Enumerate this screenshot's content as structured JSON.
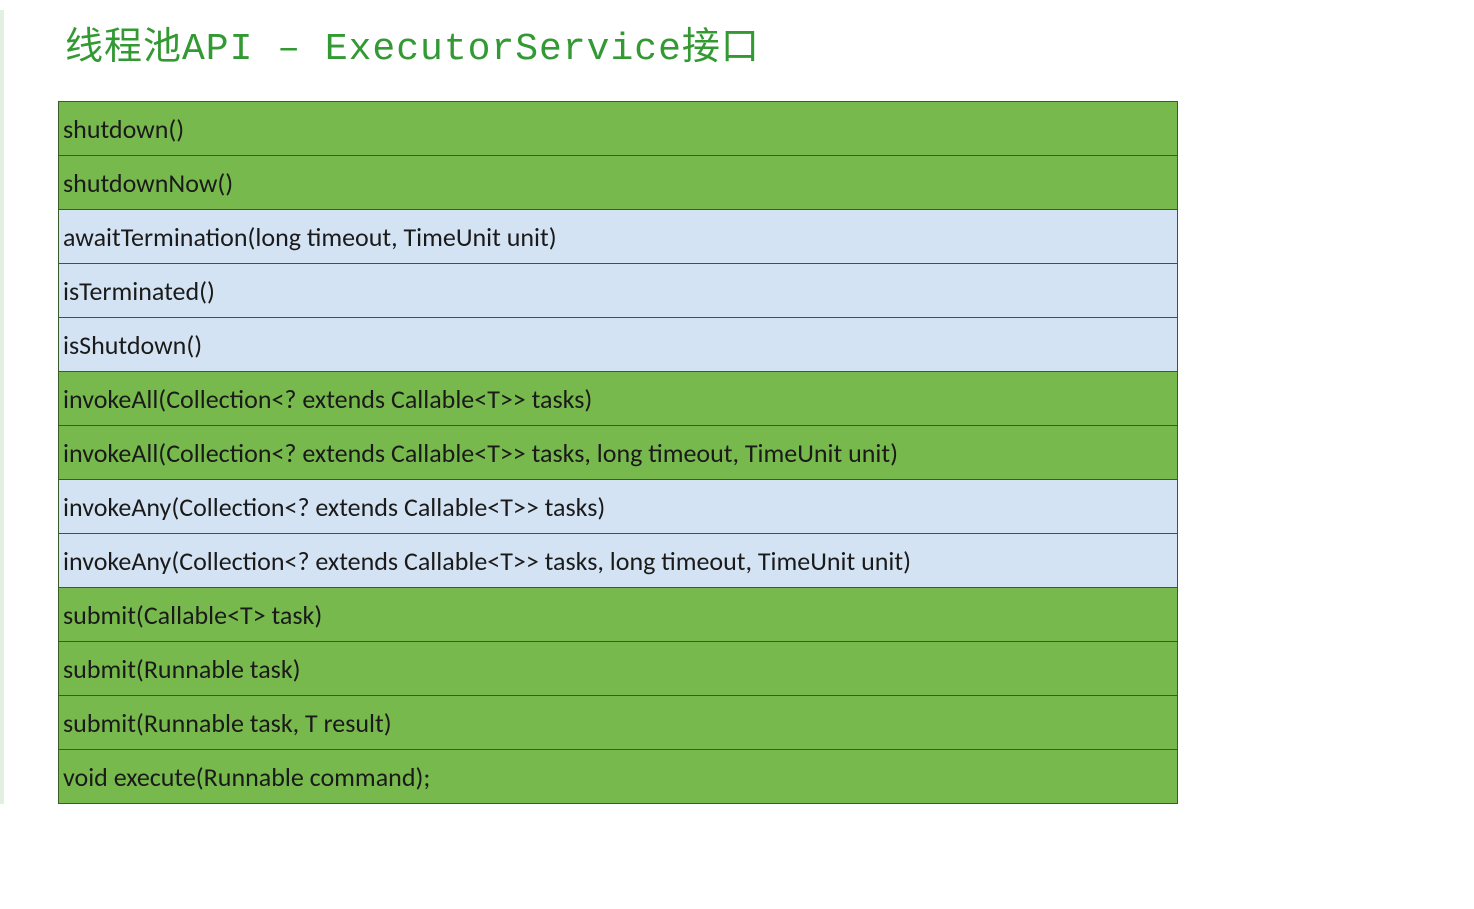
{
  "title": "线程池API – ExecutorService接口",
  "rows": [
    {
      "text": "shutdown()",
      "style": "green"
    },
    {
      "text": "shutdownNow()",
      "style": "green"
    },
    {
      "text": "awaitTermination(long timeout, TimeUnit unit)",
      "style": "blue"
    },
    {
      "text": "isTerminated()",
      "style": "blue"
    },
    {
      "text": "isShutdown()",
      "style": "blue"
    },
    {
      "text": "invokeAll(Collection<? extends Callable<T>> tasks)",
      "style": "green"
    },
    {
      "text": "invokeAll(Collection<? extends Callable<T>> tasks, long timeout, TimeUnit unit)",
      "style": "green"
    },
    {
      "text": "invokeAny(Collection<? extends Callable<T>> tasks)",
      "style": "blue"
    },
    {
      "text": "invokeAny(Collection<? extends Callable<T>> tasks, long timeout, TimeUnit unit)",
      "style": "blue"
    },
    {
      "text": "submit(Callable<T> task)",
      "style": "green"
    },
    {
      "text": "submit(Runnable task)",
      "style": "green"
    },
    {
      "text": "submit(Runnable task, T result)",
      "style": "green"
    },
    {
      "text": "void execute(Runnable command);",
      "style": "green"
    }
  ]
}
